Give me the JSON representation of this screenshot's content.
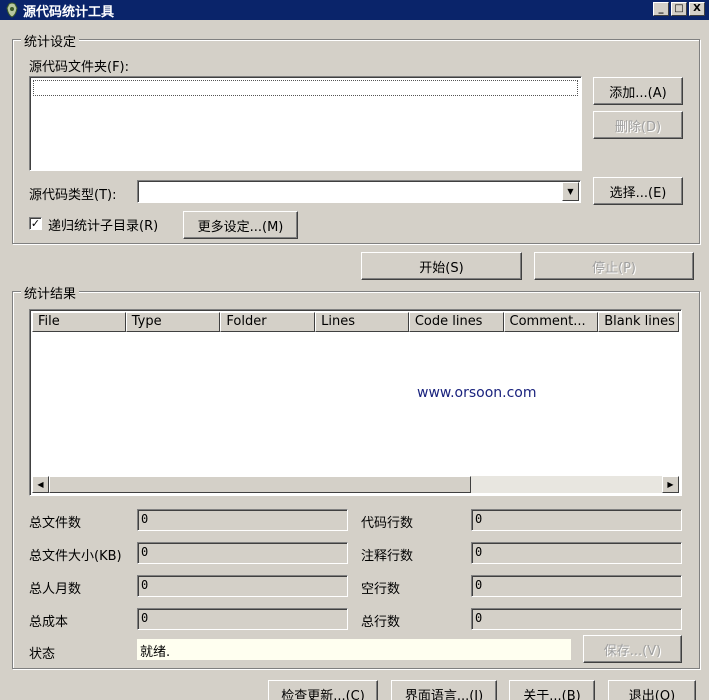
{
  "window": {
    "title": "源代码统计工具",
    "minimize": "_",
    "maximize": "□",
    "close": "X"
  },
  "settings": {
    "group_label": "统计设定",
    "folder_label": "源代码文件夹(F):",
    "add_button": "添加...(A)",
    "delete_button": "删除(D)",
    "type_label": "源代码类型(T):",
    "type_value": "",
    "select_button": "选择...(E)",
    "recursive_label": "递归统计子目录(R)",
    "recursive_checked": "✓",
    "more_settings_button": "更多设定...(M)"
  },
  "actions": {
    "start_button": "开始(S)",
    "stop_button": "停止(P)"
  },
  "results": {
    "group_label": "统计结果",
    "columns": [
      "File",
      "Type",
      "Folder",
      "Lines",
      "Code lines",
      "Comment...",
      "Blank lines"
    ],
    "watermark": "www.orsoon.com"
  },
  "stats": {
    "total_files_label": "总文件数",
    "total_files_value": "0",
    "total_size_label": "总文件大小(KB)",
    "total_size_value": "0",
    "man_months_label": "总人月数",
    "man_months_value": "0",
    "total_cost_label": "总成本",
    "total_cost_value": "0",
    "code_lines_label": "代码行数",
    "code_lines_value": "0",
    "comment_lines_label": "注释行数",
    "comment_lines_value": "0",
    "blank_lines_label": "空行数",
    "blank_lines_value": "0",
    "total_lines_label": "总行数",
    "total_lines_value": "0"
  },
  "status": {
    "label": "状态",
    "value": "就绪.",
    "save_button": "保存...(V)"
  },
  "footer": {
    "check_update": "检查更新...(C)",
    "language": "界面语言...(I)",
    "about": "关于...(B)",
    "exit": "退出(O)"
  }
}
